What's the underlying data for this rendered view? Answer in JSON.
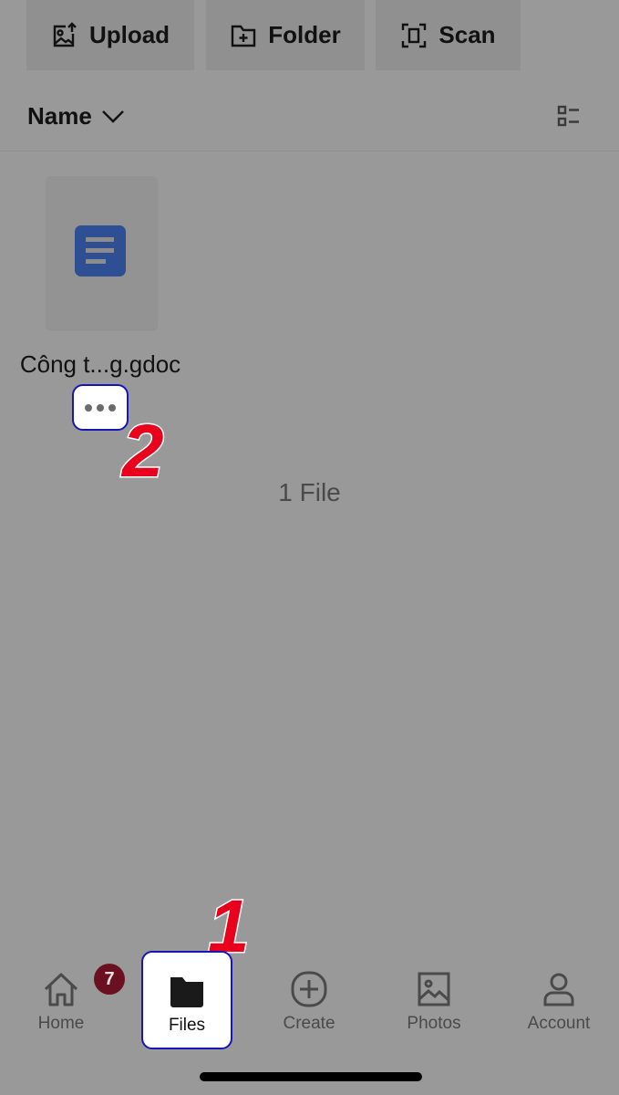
{
  "toolbar": {
    "upload_label": "Upload",
    "folder_label": "Folder",
    "scan_label": "Scan"
  },
  "sort": {
    "label": "Name"
  },
  "files": [
    {
      "name": "Công t...g.gdoc",
      "type": "gdoc",
      "icon": "google-doc-icon"
    }
  ],
  "file_count": "1 File",
  "annotations": {
    "step_1": "1",
    "step_2": "2"
  },
  "tabbar": {
    "tabs": [
      {
        "label": "Home",
        "icon": "home-icon",
        "badge": "7"
      },
      {
        "label": "Files",
        "icon": "folder-icon",
        "selected": true
      },
      {
        "label": "Create",
        "icon": "plus-circle-icon"
      },
      {
        "label": "Photos",
        "icon": "photo-icon"
      },
      {
        "label": "Account",
        "icon": "person-icon"
      }
    ]
  },
  "colors": {
    "highlight_border": "#1515b8",
    "marker_red": "#e8001c",
    "doc_blue": "#2f4f95",
    "badge_bg": "#6a1020"
  }
}
